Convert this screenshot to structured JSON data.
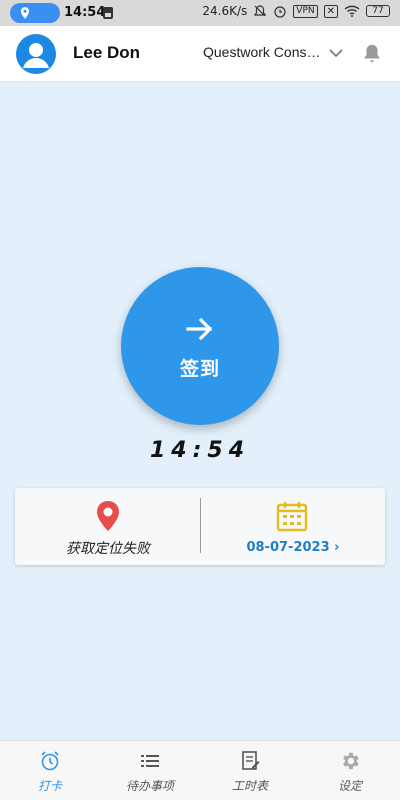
{
  "status_bar": {
    "time": "14:54",
    "network_speed": "24.6K/s",
    "vpn": "VPN",
    "battery": "77"
  },
  "header": {
    "user_name": "Lee Don",
    "company": "Questwork Consulting",
    "colors": {
      "avatar": "#1e88e5"
    }
  },
  "checkin": {
    "button_label": "签到",
    "clock": "14:54",
    "colors": {
      "button": "#2f97ea"
    }
  },
  "info_card": {
    "location_status": "获取定位失败",
    "date": "08-07-2023",
    "colors": {
      "pin": "#e84c4c",
      "calendar": "#e2bc1c",
      "date": "#1e7fc9"
    }
  },
  "bottom_nav": {
    "items": [
      {
        "label": "打卡",
        "icon": "alarm-clock-icon",
        "active": true
      },
      {
        "label": "待办事项",
        "icon": "list-icon",
        "active": false
      },
      {
        "label": "工时表",
        "icon": "timesheet-icon",
        "active": false
      },
      {
        "label": "设定",
        "icon": "gear-icon",
        "active": false
      }
    ],
    "colors": {
      "active": "#2f97ea",
      "inactive": "#555555"
    }
  }
}
